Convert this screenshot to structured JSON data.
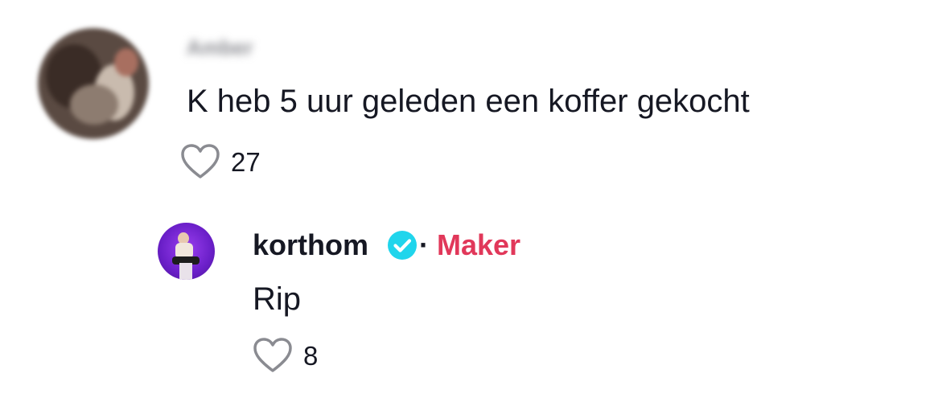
{
  "comment": {
    "username": "Amber",
    "text": "K heb 5 uur geleden een koffer gekocht",
    "likes": "27"
  },
  "reply": {
    "username": "korthom",
    "verified": true,
    "separator": "·",
    "badge": "Maker",
    "text": "Rip",
    "likes": "8"
  },
  "colors": {
    "text": "#161823",
    "maker_badge": "#e1385a",
    "verified": "#20d5ec"
  }
}
